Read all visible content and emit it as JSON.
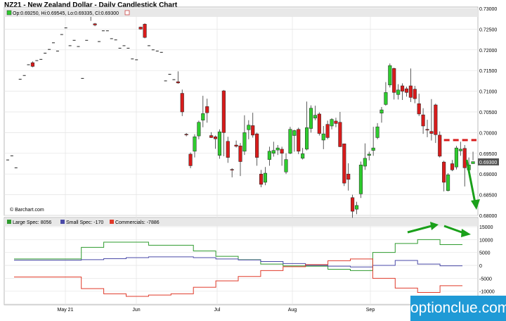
{
  "header": {
    "title": "NZ21 - New Zealand Dollar - Daily Candlestick Chart"
  },
  "watermark": "© Barchart.com",
  "brand": {
    "name": "optionclue.com",
    "color": "#1f9ad6"
  },
  "colors": {
    "up": "#2ecc2e",
    "down": "#d81b1b",
    "large": "#2e9b2e",
    "small": "#4a4aa8",
    "comm": "#e03a2a",
    "arrow": "#1aa01a"
  },
  "chart_data": [
    {
      "type": "candlestick",
      "title": "NZ21 - New Zealand Dollar - Daily Candlestick Chart",
      "legend": "Op:0.69250, Hi:0.69545, Lo:0.69335, Cl:0.69300",
      "ylim": [
        0.68,
        0.73
      ],
      "ytick_labels": [
        "0.73000",
        "0.72500",
        "0.72000",
        "0.71500",
        "0.71000",
        "0.70500",
        "0.70000",
        "0.69500",
        "0.69000",
        "0.68500",
        "0.68000"
      ],
      "last_price": "0.69300",
      "x_labels": [
        "May 21",
        "Jun",
        "Jul",
        "Aug",
        "Sep"
      ],
      "resistance_level": 0.6982,
      "candles": [
        [
          0.6934,
          0.6934,
          0.6934,
          0.6934
        ],
        [
          0.6944,
          0.6944,
          0.6944,
          0.6944
        ],
        [
          0.6915,
          0.6915,
          0.6915,
          0.6915
        ],
        [
          0.7129,
          0.7129,
          0.7129,
          0.7129
        ],
        [
          0.7138,
          0.7138,
          0.7138,
          0.7138
        ],
        [
          0.7164,
          0.7164,
          0.7164,
          0.7164
        ],
        [
          0.7169,
          0.716,
          0.7172,
          0.7158
        ],
        [
          0.7174,
          0.7174,
          0.7174,
          0.7174
        ],
        [
          0.7177,
          0.7177,
          0.7177,
          0.7177
        ],
        [
          0.7192,
          0.7192,
          0.7192,
          0.7192
        ],
        [
          0.7201,
          0.7201,
          0.7201,
          0.7201
        ],
        [
          0.7217,
          0.7217,
          0.7217,
          0.7217
        ],
        [
          0.7197,
          0.7197,
          0.7197,
          0.7197
        ],
        [
          0.7237,
          0.7237,
          0.7237,
          0.7237
        ],
        [
          0.7253,
          0.7253,
          0.7253,
          0.7253
        ],
        [
          0.721,
          0.721,
          0.721,
          0.721
        ],
        [
          0.7223,
          0.7223,
          0.7223,
          0.7223
        ],
        [
          0.7208,
          0.7208,
          0.7208,
          0.7208
        ],
        [
          0.7131,
          0.7131,
          0.7131,
          0.7131
        ],
        [
          0.7223,
          0.7223,
          0.7223,
          0.7223
        ],
        [
          0.7286,
          0.728,
          0.7296,
          0.727
        ],
        [
          0.7263,
          0.726,
          0.7265,
          0.7257
        ],
        [
          0.722,
          0.722,
          0.722,
          0.722
        ],
        [
          0.7246,
          0.7246,
          0.7246,
          0.7246
        ],
        [
          0.7246,
          0.7246,
          0.7246,
          0.7246
        ],
        [
          0.7227,
          0.7227,
          0.7227,
          0.7227
        ],
        [
          0.7224,
          0.7224,
          0.7224,
          0.7224
        ],
        [
          0.7204,
          0.7204,
          0.7204,
          0.7204
        ],
        [
          0.721,
          0.721,
          0.721,
          0.721
        ],
        [
          0.7204,
          0.7204,
          0.7204,
          0.7204
        ],
        [
          0.7178,
          0.7178,
          0.7178,
          0.7178
        ],
        [
          0.7176,
          0.7176,
          0.7176,
          0.7176
        ],
        [
          0.7255,
          0.725,
          0.7256,
          0.7249
        ],
        [
          0.7262,
          0.723,
          0.7264,
          0.7228
        ],
        [
          0.721,
          0.721,
          0.721,
          0.721
        ],
        [
          0.72,
          0.72,
          0.72,
          0.72
        ],
        [
          0.7197,
          0.7197,
          0.7197,
          0.7197
        ],
        [
          0.7194,
          0.7194,
          0.7194,
          0.7194
        ],
        [
          0.7125,
          0.7125,
          0.7125,
          0.7125
        ],
        [
          0.7141,
          0.7141,
          0.7141,
          0.7141
        ],
        [
          0.7128,
          0.7128,
          0.7128,
          0.7128
        ],
        [
          0.7123,
          0.712,
          0.7148,
          0.7118
        ],
        [
          0.7095,
          0.705,
          0.7104,
          0.704
        ],
        [
          0.6996,
          0.6995,
          0.6999,
          0.6991
        ],
        [
          0.6948,
          0.692,
          0.6952,
          0.6914
        ],
        [
          0.6955,
          0.699,
          0.6996,
          0.694
        ],
        [
          0.6992,
          0.7025,
          0.7029,
          0.6984
        ],
        [
          0.703,
          0.7046,
          0.7089,
          0.7013
        ],
        [
          0.7063,
          0.7048,
          0.7082,
          0.7024
        ],
        [
          0.6993,
          0.6988,
          0.7001,
          0.6987
        ],
        [
          0.699,
          0.6985,
          0.6993,
          0.6961
        ],
        [
          0.6945,
          0.7002,
          0.7008,
          0.6937
        ],
        [
          0.7101,
          0.7,
          0.7103,
          0.6943
        ],
        [
          0.6979,
          0.694,
          0.699,
          0.6927
        ],
        [
          0.6911,
          0.691,
          0.6914,
          0.6892
        ],
        [
          0.697,
          0.6967,
          0.6981,
          0.6964
        ],
        [
          0.6968,
          0.693,
          0.6975,
          0.6895
        ],
        [
          0.6955,
          0.7,
          0.7042,
          0.6946
        ],
        [
          0.7007,
          0.7018,
          0.703,
          0.6984
        ],
        [
          0.7017,
          0.6994,
          0.7048,
          0.6988
        ],
        [
          0.6997,
          0.694,
          0.7,
          0.692
        ],
        [
          0.69,
          0.6875,
          0.691,
          0.6868
        ],
        [
          0.688,
          0.6902,
          0.6917,
          0.6873
        ],
        [
          0.6935,
          0.6955,
          0.6966,
          0.692
        ],
        [
          0.695,
          0.6957,
          0.6978,
          0.6942
        ],
        [
          0.6958,
          0.6963,
          0.697,
          0.6946
        ],
        [
          0.696,
          0.695,
          0.6966,
          0.692
        ],
        [
          0.6905,
          0.6935,
          0.695,
          0.69
        ],
        [
          0.695,
          0.7008,
          0.7014,
          0.6948
        ],
        [
          0.6993,
          0.7005,
          0.7007,
          0.6954
        ],
        [
          0.7008,
          0.6955,
          0.7012,
          0.6948
        ],
        [
          0.6938,
          0.6949,
          0.6963,
          0.6935
        ],
        [
          0.696,
          0.7012,
          0.7075,
          0.6957
        ],
        [
          0.701,
          0.7059,
          0.7066,
          0.7
        ],
        [
          0.7035,
          0.7042,
          0.7065,
          0.703
        ],
        [
          0.7045,
          0.6998,
          0.7049,
          0.6993
        ],
        [
          0.6982,
          0.6997,
          0.7016,
          0.696
        ],
        [
          0.702,
          0.6988,
          0.7029,
          0.6984
        ],
        [
          0.7016,
          0.7032,
          0.7035,
          0.7008
        ],
        [
          0.7028,
          0.7022,
          0.7036,
          0.7013
        ],
        [
          0.7025,
          0.6966,
          0.705,
          0.6965
        ],
        [
          0.6973,
          0.6878,
          0.6973,
          0.6871
        ],
        [
          0.69,
          0.6887,
          0.6926,
          0.686
        ],
        [
          0.6843,
          0.681,
          0.685,
          0.6794
        ],
        [
          0.6815,
          0.6824,
          0.6833,
          0.6803
        ],
        [
          0.6852,
          0.6922,
          0.693,
          0.6842
        ],
        [
          0.6919,
          0.6938,
          0.6974,
          0.691
        ],
        [
          0.6945,
          0.6948,
          0.6954,
          0.6933
        ],
        [
          0.6957,
          0.6963,
          0.7014,
          0.6944
        ],
        [
          0.6988,
          0.7014,
          0.7023,
          0.6984
        ],
        [
          0.7047,
          0.7055,
          0.7062,
          0.7024
        ],
        [
          0.7068,
          0.7097,
          0.7122,
          0.7065
        ],
        [
          0.7115,
          0.7162,
          0.7167,
          0.7109
        ],
        [
          0.7155,
          0.7097,
          0.7157,
          0.708
        ],
        [
          0.7092,
          0.7103,
          0.7117,
          0.708
        ],
        [
          0.7113,
          0.71,
          0.7119,
          0.7079
        ],
        [
          0.7106,
          0.7097,
          0.7111,
          0.7087
        ],
        [
          0.7113,
          0.7085,
          0.7155,
          0.7074
        ],
        [
          0.7105,
          0.7082,
          0.7113,
          0.7071
        ],
        [
          0.707,
          0.7045,
          0.7094,
          0.704
        ],
        [
          0.7043,
          0.7016,
          0.7059,
          0.6997
        ],
        [
          0.7008,
          0.7006,
          0.7031,
          0.6989
        ],
        [
          0.7003,
          0.6998,
          0.7081,
          0.6981
        ],
        [
          0.7067,
          0.6995,
          0.707,
          0.6975
        ],
        [
          0.6994,
          0.6943,
          0.7003,
          0.694
        ],
        [
          0.6929,
          0.688,
          0.6932,
          0.6858
        ],
        [
          0.686,
          0.6898,
          0.6902,
          0.6858
        ],
        [
          0.6925,
          0.691,
          0.6934,
          0.6907
        ],
        [
          0.6917,
          0.6963,
          0.6968,
          0.6911
        ],
        [
          0.6956,
          0.696,
          0.6978,
          0.6944
        ],
        [
          0.6962,
          0.6915,
          0.697,
          0.687
        ],
        [
          0.691,
          0.6922,
          0.694,
          0.6904
        ],
        [
          0.6925,
          0.693,
          0.6954,
          0.6933
        ]
      ]
    },
    {
      "type": "line",
      "title": "COT",
      "legend": [
        "Large Spec: 8056",
        "Small Spec: -170",
        "Commercials: -7886"
      ],
      "ylim": [
        -15000,
        15000
      ],
      "ytick_labels": [
        "15000",
        "10000",
        "5000",
        "0",
        "-5000",
        "-10000",
        "-15000"
      ],
      "series": [
        {
          "name": "Large Spec",
          "values": [
            2500,
            2500,
            2500,
            7000,
            9000,
            9000,
            7800,
            7800,
            5600,
            3500,
            2200,
            500,
            -200,
            -300,
            -1500,
            -2000,
            5000,
            8500,
            10000,
            8056
          ]
        },
        {
          "name": "Small Spec",
          "values": [
            2000,
            2000,
            2000,
            2200,
            2600,
            3000,
            3300,
            3300,
            3000,
            2500,
            2100,
            1500,
            700,
            0,
            -300,
            -600,
            0,
            1900,
            500,
            -170
          ]
        },
        {
          "name": "Commercials",
          "values": [
            -4500,
            -4500,
            -4500,
            -9000,
            -11000,
            -12000,
            -11500,
            -11000,
            -8500,
            -6000,
            -4300,
            -2000,
            -500,
            300,
            1800,
            2500,
            -5000,
            -8800,
            -10500,
            -7886
          ]
        }
      ]
    }
  ]
}
